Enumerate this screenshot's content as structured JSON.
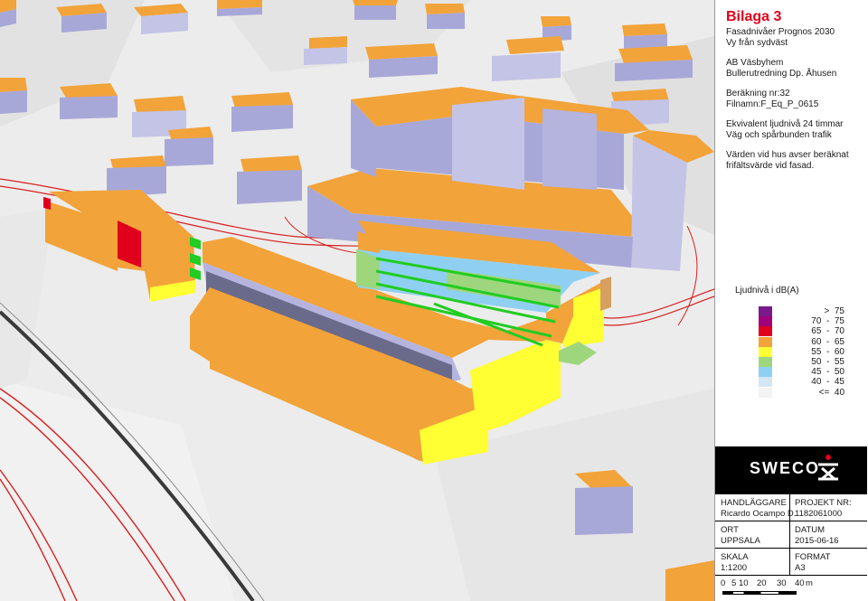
{
  "title": "Bilaga 3",
  "header_lines": [
    "Fasadnivåer Prognos 2030",
    "Vy från sydväst"
  ],
  "client_lines": [
    "AB Väsbyhem",
    "Bullerutredning Dp. Åhusen"
  ],
  "calc_lines": [
    "Beräkning nr:32",
    "Filnamn:F_Eq_P_0615"
  ],
  "desc_lines": [
    "Ekvivalent ljudnivå 24 timmar",
    "Väg och spårbunden trafik"
  ],
  "note_lines": [
    "Värden vid hus avser beräknat",
    "frifältsvärde vid fasad."
  ],
  "legend": {
    "title": "Ljudnivå i dB(A)",
    "items": [
      {
        "label": ">  75",
        "color": "#7a1a8a"
      },
      {
        "label": "70  -  75",
        "color": "#a0007a"
      },
      {
        "label": "65  -  70",
        "color": "#e0001c"
      },
      {
        "label": "60  -  65",
        "color": "#f2a33a"
      },
      {
        "label": "55  -  60",
        "color": "#ffff33"
      },
      {
        "label": "50  -  55",
        "color": "#9ed67e"
      },
      {
        "label": "45  -  50",
        "color": "#8fd0f2"
      },
      {
        "label": "40  -  45",
        "color": "#d4e6f4"
      },
      {
        "label": "<=  40",
        "color": "#f3f3f3"
      }
    ]
  },
  "logo": "SWECO",
  "info": {
    "handlaggare_label": "HANDLÄGGARE",
    "handlaggare_value": "Ricardo Ocampo D.",
    "projekt_label": "PROJEKT NR:",
    "projekt_value": "1182061000",
    "ort_label": "ORT",
    "ort_value": "UPPSALA",
    "datum_label": "DATUM",
    "datum_value": "2015-06-16",
    "skala_label": "SKALA",
    "skala_value": "1:1200",
    "format_label": "FORMAT",
    "format_value": "A3",
    "scale_ticks": [
      "0",
      "5",
      "10",
      "20",
      "30",
      "40"
    ],
    "scale_unit": "m"
  },
  "colors": {
    "roof": "#f2a33a",
    "wall_shadow": "#a8a8d8",
    "wall_light": "#c4c4e6",
    "ground": "#ececec",
    "road_red": "#d82020",
    "rail_dark": "#3a3a3a",
    "accent_title": "#e1001a"
  }
}
